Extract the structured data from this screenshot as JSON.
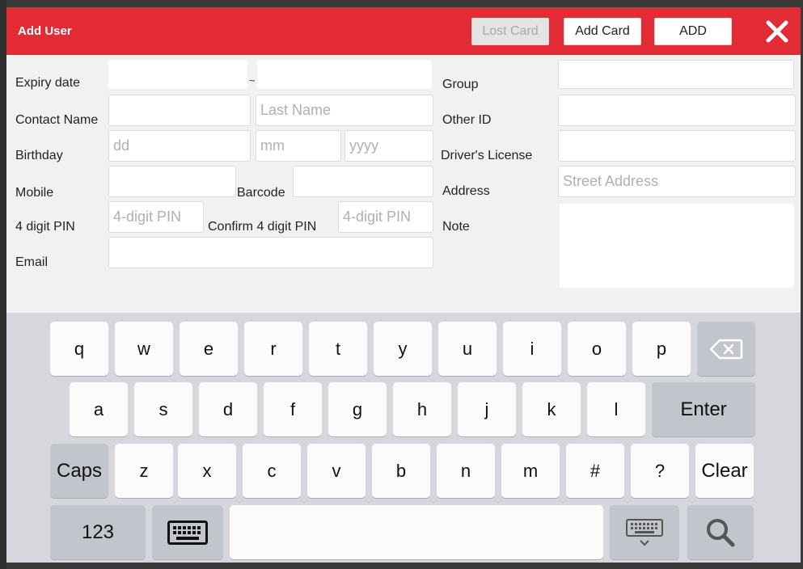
{
  "dialog": {
    "title": "Add User",
    "lost_card_label": "Lost Card",
    "add_card_label": "Add Card",
    "add_label": "ADD",
    "colors": {
      "header": "#e32b36",
      "close": "#ffffff",
      "disabled_text": "#a8a8a8",
      "placeholder": "#b0b0b0"
    }
  },
  "form": {
    "expiry_label": "Expiry date",
    "expiry_separator": "~",
    "contact_name_label": "Contact Name",
    "last_name_placeholder": "Last Name",
    "birthday_label": "Birthday",
    "day_placeholder": "dd",
    "month_placeholder": "mm",
    "year_placeholder": "yyyy",
    "mobile_label": "Mobile",
    "barcode_label": "Barcode",
    "pin_label": "4 digit PIN",
    "pin_placeholder": "4-digit PIN",
    "confirm_pin_label": "Confirm 4 digit PIN",
    "confirm_pin_placeholder": "4-digit PIN",
    "email_label": "Email",
    "group_label": "Group",
    "other_id_label": "Other ID",
    "drivers_license_label": "Driver's License",
    "address_label": "Address",
    "street_address_placeholder": "Street Address",
    "note_label": "Note"
  },
  "keyboard": {
    "row1": [
      "q",
      "w",
      "e",
      "r",
      "t",
      "y",
      "u",
      "i",
      "o",
      "p"
    ],
    "row2": [
      "a",
      "s",
      "d",
      "f",
      "g",
      "h",
      "j",
      "k",
      "l"
    ],
    "row3": [
      "z",
      "x",
      "c",
      "v",
      "b",
      "n",
      "m",
      "#",
      "?"
    ],
    "enter_label": "Enter",
    "caps_label": "Caps",
    "clear_label": "Clear",
    "numbers_label": "123",
    "icons": [
      "backspace-icon",
      "keyboard-icon",
      "hide-keyboard-icon",
      "search-icon"
    ]
  }
}
